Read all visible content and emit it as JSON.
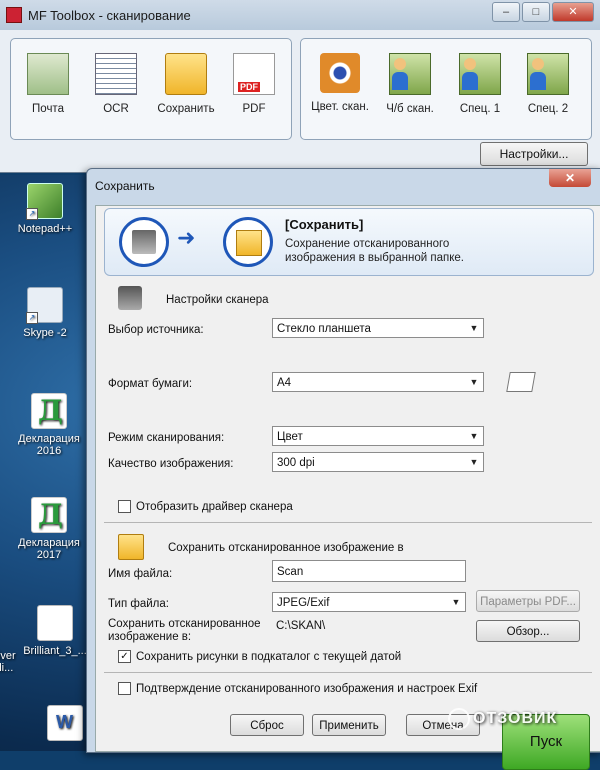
{
  "toolbox": {
    "title": "MF Toolbox - сканирование",
    "window_buttons": {
      "minimize": "–",
      "maximize": "□",
      "close": "✕"
    },
    "left_tools": [
      {
        "label": "Почта",
        "icon": "mail-icon"
      },
      {
        "label": "OCR",
        "icon": "ocr-icon"
      },
      {
        "label": "Сохранить",
        "icon": "folder-icon"
      },
      {
        "label": "PDF",
        "icon": "pdf-icon"
      }
    ],
    "right_tools": [
      {
        "label": "Цвет. скан.",
        "icon": "eye-scan-icon"
      },
      {
        "label": "Ч/б скан.",
        "icon": "user-scan-icon"
      },
      {
        "label": "Спец. 1",
        "icon": "user-scan-icon"
      },
      {
        "label": "Спец. 2",
        "icon": "user-scan-icon"
      }
    ],
    "settings_button": "Настройки..."
  },
  "desktop": {
    "icons": [
      "Notepad++",
      "Skype -2",
      "Декларация 2016",
      "Декларация 2017",
      "Brilliant_3_...",
      "river",
      "ili..."
    ]
  },
  "dialog": {
    "title": "Сохранить",
    "close": "✕",
    "header": {
      "title": "[Сохранить]",
      "description": "Сохранение отсканированного изображения в выбранной папке."
    },
    "scanner_settings": {
      "heading": "Настройки сканера",
      "source_label": "Выбор источника:",
      "source_value": "Стекло планшета",
      "paper_label": "Формат бумаги:",
      "paper_value": "A4",
      "mode_label": "Режим сканирования:",
      "mode_value": "Цвет",
      "quality_label": "Качество изображения:",
      "quality_value": "300 dpi",
      "show_driver_label": "Отобразить драйвер сканера",
      "show_driver_checked": false
    },
    "save_settings": {
      "heading": "Сохранить отсканированное изображение в",
      "filename_label": "Имя файла:",
      "filename_value": "Scan",
      "filetype_label": "Тип файла:",
      "filetype_value": "JPEG/Exif",
      "pdf_params_button": "Параметры PDF...",
      "save_to_label": "Сохранить отсканированное изображение в:",
      "save_to_value": "C:\\SKAN\\",
      "browse_button": "Обзор...",
      "subfolder_label": "Сохранить рисунки в подкаталог с текущей датой",
      "subfolder_checked": true
    },
    "confirm_label": "Подтверждение отсканированного изображения и настроек Exif",
    "confirm_checked": false,
    "buttons": {
      "reset": "Сброс",
      "apply": "Применить",
      "cancel": "Отмена",
      "go": "Пуск"
    }
  },
  "watermark": "ОТЗОВИК"
}
